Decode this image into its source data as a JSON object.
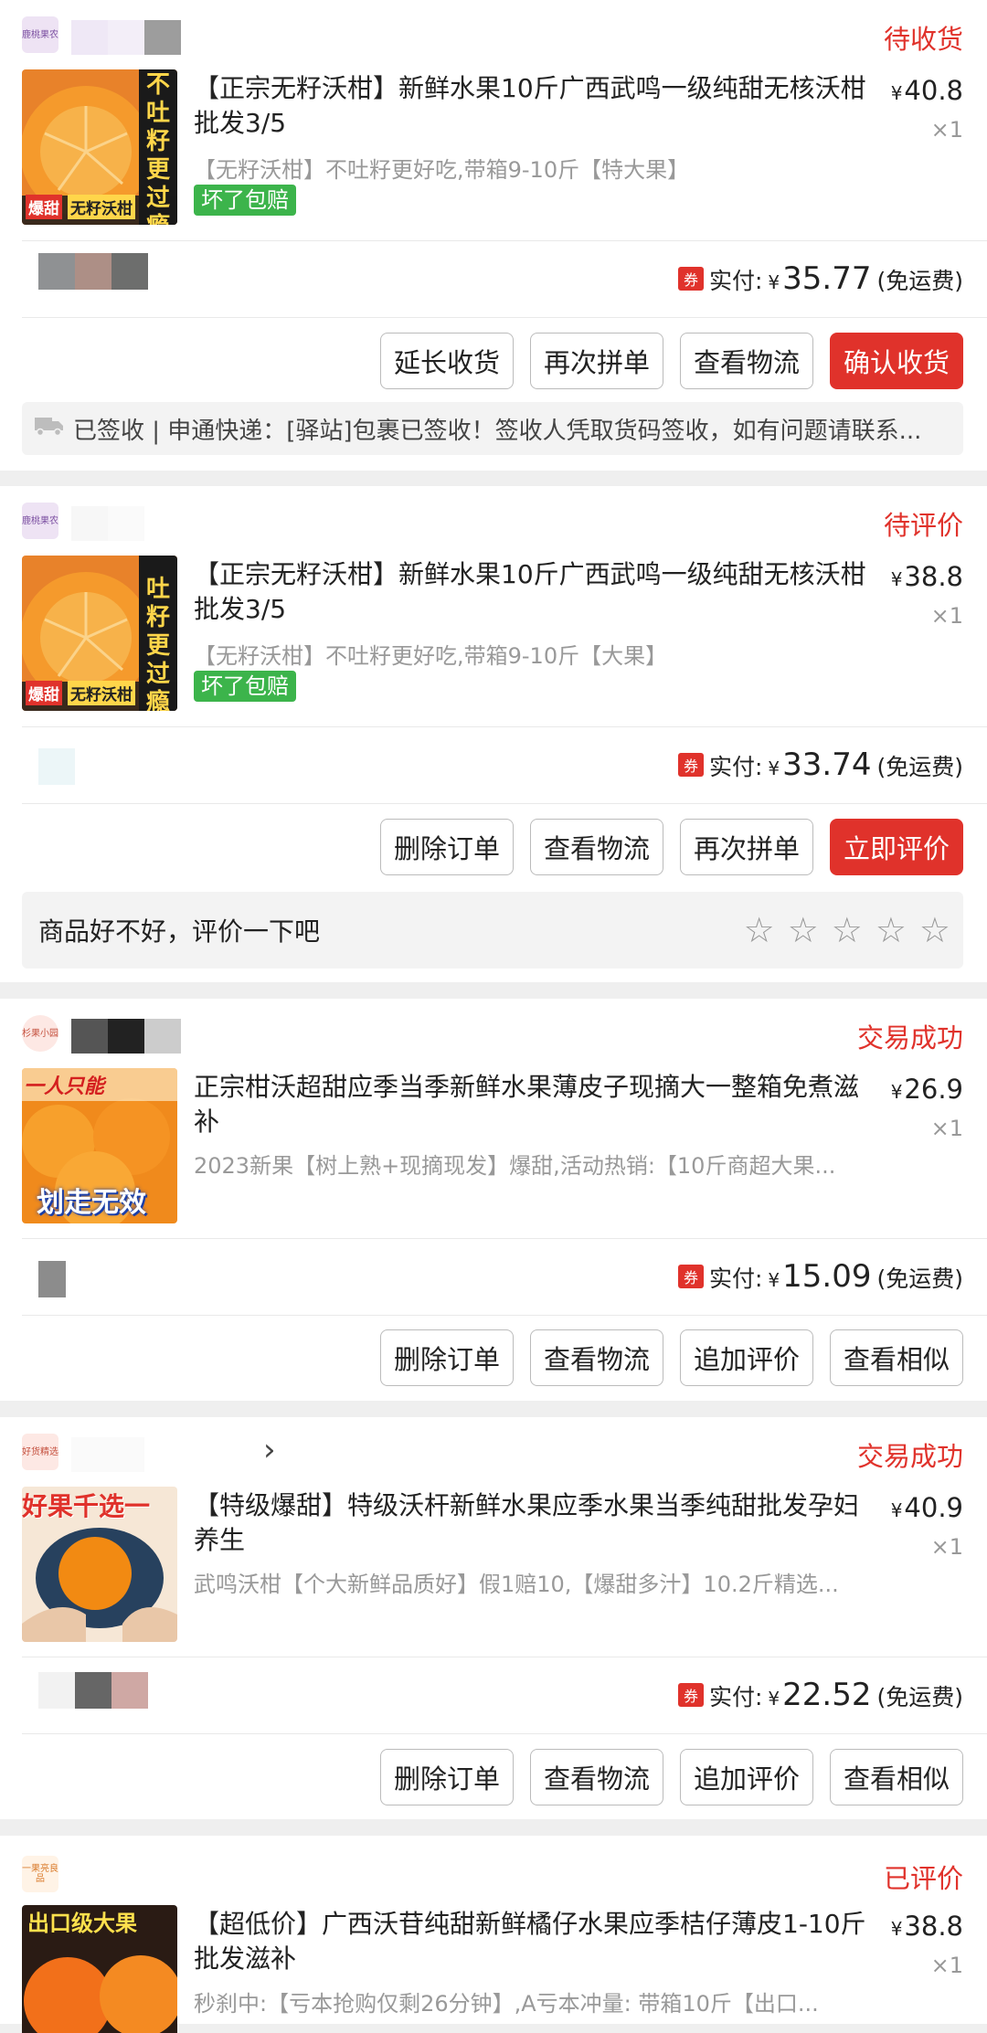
{
  "orders": [
    {
      "shop_logo_text": "鹿桃果农",
      "status": "待收货",
      "thumb_text": [
        "不吐籽更过瘾",
        "爆甜",
        "无籽沃柑"
      ],
      "title": "【正宗无籽沃柑】新鲜水果10斤广西武鸣一级纯甜无核沃柑批发3/5",
      "price": "40.8",
      "qty": "×1",
      "spec": "【无籽沃柑】不吐籽更好吃,带箱9-10斤【特大果】",
      "badge": "坏了包赔",
      "coupon": "券",
      "paid_label": "实付:",
      "paid_amount": "35.77",
      "paid_note": "(免运费)",
      "buttons": [
        "延长收货",
        "再次拼单",
        "查看物流",
        "确认收货"
      ],
      "logistics": "已签收 | 申通快递：[驿站]包裹已签收！签收人凭取货码签收，如有问题请联系..."
    },
    {
      "shop_logo_text": "鹿桃果农",
      "status": "待评价",
      "thumb_text": [
        "吐籽更过瘾",
        "爆甜",
        "无籽沃柑"
      ],
      "title": "【正宗无籽沃柑】新鲜水果10斤广西武鸣一级纯甜无核沃柑批发3/5",
      "price": "38.8",
      "qty": "×1",
      "spec": "【无籽沃柑】不吐籽更好吃,带箱9-10斤【大果】",
      "badge": "坏了包赔",
      "coupon": "券",
      "paid_label": "实付:",
      "paid_amount": "33.74",
      "paid_note": "(免运费)",
      "buttons": [
        "删除订单",
        "查看物流",
        "再次拼单",
        "立即评价"
      ],
      "review_prompt": "商品好不好，评价一下吧"
    },
    {
      "shop_logo_text": "杉果小园",
      "status": "交易成功",
      "thumb_text": [
        "一人只能",
        "划走无效"
      ],
      "title": "正宗柑沃超甜应季当季新鲜水果薄皮子现摘大一整箱免煮滋补",
      "price": "26.9",
      "qty": "×1",
      "spec": "2023新果【树上熟+现摘现发】爆甜,活动热销:【10斤商超大果...",
      "coupon": "券",
      "paid_label": "实付:",
      "paid_amount": "15.09",
      "paid_note": "(免运费)",
      "buttons": [
        "删除订单",
        "查看物流",
        "追加评价",
        "查看相似"
      ]
    },
    {
      "shop_logo_text": "好货精选",
      "status": "交易成功",
      "thumb_text": [
        "好果千选一"
      ],
      "title": "【特级爆甜】特级沃杆新鲜水果应季水果当季纯甜批发孕妇养生",
      "price": "40.9",
      "qty": "×1",
      "spec": "武鸣沃柑【个大新鲜品质好】假1赔10,【爆甜多汁】10.2斤精选...",
      "coupon": "券",
      "paid_label": "实付:",
      "paid_amount": "22.52",
      "paid_note": "(免运费)",
      "buttons": [
        "删除订单",
        "查看物流",
        "追加评价",
        "查看相似"
      ]
    },
    {
      "shop_logo_text": "一果亮良品",
      "status": "已评价",
      "thumb_text": [
        "出口级大果"
      ],
      "title": "【超低价】广西沃苷纯甜新鲜橘仔水果应季桔仔薄皮1-10斤批发滋补",
      "price": "38.8",
      "qty": "×1",
      "spec": "秒刹中:【亏本抢购仅剩26分钟】,A亏本冲量: 带箱10斤【出口..."
    }
  ],
  "chevron": "›",
  "yen": "¥",
  "colors": {
    "accent": "#e0322b",
    "badge": "#3cb44b"
  }
}
